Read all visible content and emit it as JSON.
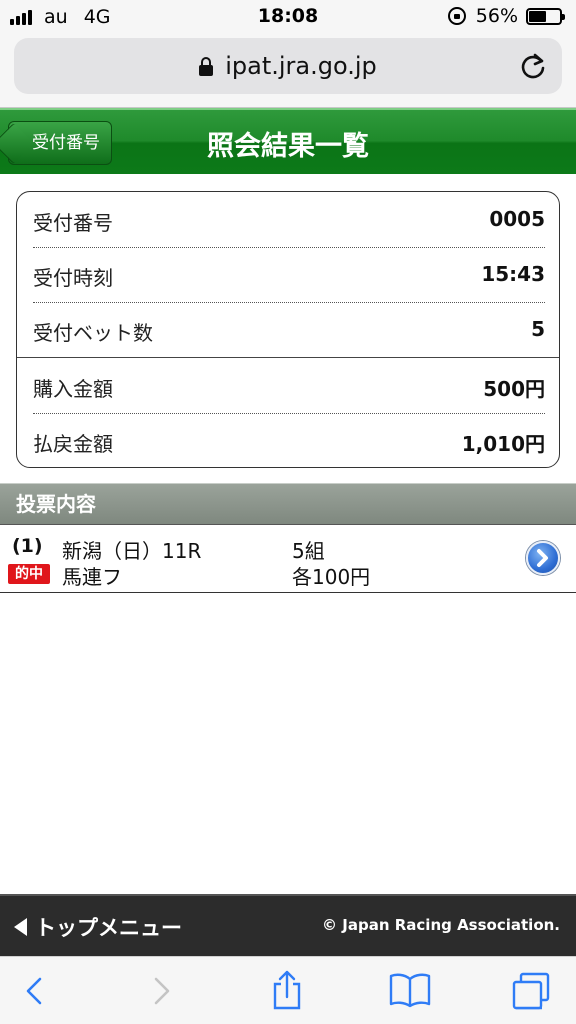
{
  "status_bar": {
    "carrier": "au",
    "network": "4G",
    "time": "18:08",
    "battery_percent": "56%",
    "battery_level": 0.56
  },
  "browser": {
    "url": "ipat.jra.go.jp"
  },
  "header": {
    "back_label": "受付番号",
    "title": "照会結果一覧"
  },
  "receipt": {
    "rows": [
      {
        "label": "受付番号",
        "value": "0005"
      },
      {
        "label": "受付時刻",
        "value": "15:43"
      },
      {
        "label": "受付ベット数",
        "value": "5"
      },
      {
        "label": "購入金額",
        "value": "500円"
      },
      {
        "label": "払戻金額",
        "value": "1,010円"
      }
    ]
  },
  "section": {
    "title": "投票内容"
  },
  "bet": {
    "number": "(1)",
    "venue_race": "新潟（日）11R",
    "combinations": "5組",
    "result_badge": "的中",
    "bet_type": "馬連フ",
    "amount_each": "各100円"
  },
  "footer": {
    "top_menu": "トップメニュー",
    "copyright": "© Japan Racing Association."
  },
  "colors": {
    "header_green": "#1f8a2b",
    "hit_red": "#e0161b",
    "chevron_blue": "#2f6ed4"
  }
}
